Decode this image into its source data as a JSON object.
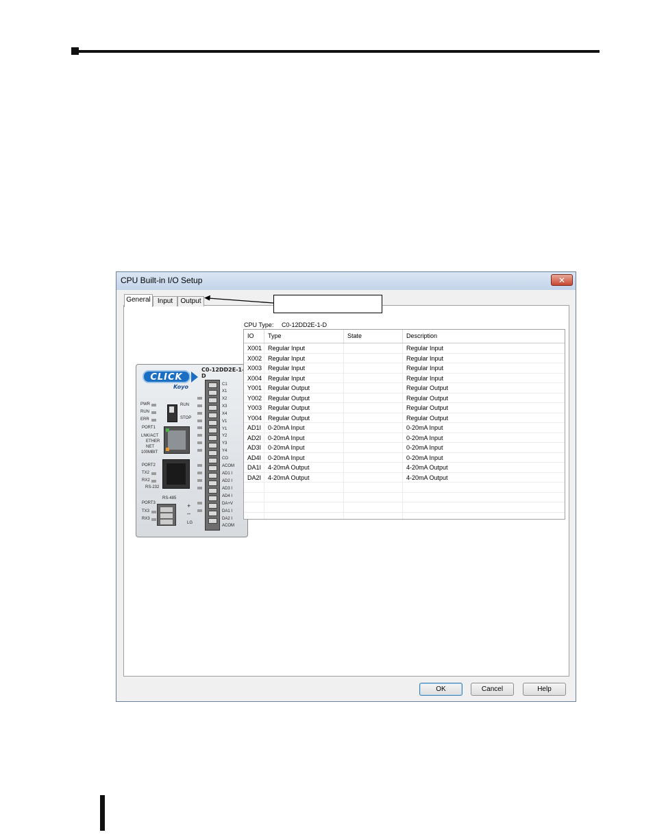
{
  "dialog": {
    "title": "CPU Built-in I/O Setup",
    "close_glyph": "✕",
    "tabs": [
      {
        "label": "General",
        "active": true
      },
      {
        "label": "Input",
        "active": false
      },
      {
        "label": "Output",
        "active": false
      }
    ],
    "cpu_type_label": "CPU Type:",
    "cpu_type_value": "C0-12DD2E-1-D",
    "buttons": {
      "ok": "OK",
      "cancel": "Cancel",
      "help": "Help"
    }
  },
  "device": {
    "brand": "CLICK",
    "sub_brand": "Koyo",
    "model": "C0-12DD2E-1-D",
    "left_labels": {
      "pwr": "PWR",
      "run": "RUN",
      "err": "ERR",
      "port1": "PORT1",
      "lnk_act": "LNK/ACT",
      "ether": "ETHER",
      "net": "NET",
      "speed": "100MBIT",
      "port2": "PORT2",
      "tx2": "TX2",
      "rx2": "RX2",
      "rs232": "RS-232",
      "rs485": "RS-485",
      "port3": "PORT3",
      "tx3": "TX3",
      "rx3": "RX3",
      "plus": "+",
      "minus": "–",
      "lg": "LG"
    },
    "switch_labels": {
      "run": "RUN",
      "stop": "STOP"
    },
    "terminals": [
      "C1",
      "X1",
      "X2",
      "X3",
      "X4",
      "V1",
      "Y1",
      "Y2",
      "Y3",
      "Y4",
      "CO",
      "ACOM",
      "AD1 I",
      "AD2 I",
      "AD3 I",
      "AD4 I",
      "DA+V",
      "DA1 I",
      "DA2 I",
      "ACOM"
    ]
  },
  "io_table": {
    "columns": [
      "IO",
      "Type",
      "State",
      "Description"
    ],
    "rows": [
      {
        "io": "X001",
        "type": "Regular Input",
        "state": "",
        "description": "Regular Input"
      },
      {
        "io": "X002",
        "type": "Regular Input",
        "state": "",
        "description": "Regular Input"
      },
      {
        "io": "X003",
        "type": "Regular Input",
        "state": "",
        "description": "Regular Input"
      },
      {
        "io": "X004",
        "type": "Regular Input",
        "state": "",
        "description": "Regular Input"
      },
      {
        "io": "Y001",
        "type": "Regular Output",
        "state": "",
        "description": "Regular Output"
      },
      {
        "io": "Y002",
        "type": "Regular Output",
        "state": "",
        "description": "Regular Output"
      },
      {
        "io": "Y003",
        "type": "Regular Output",
        "state": "",
        "description": "Regular Output"
      },
      {
        "io": "Y004",
        "type": "Regular Output",
        "state": "",
        "description": "Regular Output"
      },
      {
        "io": "AD1I",
        "type": "0-20mA Input",
        "state": "",
        "description": "0-20mA Input"
      },
      {
        "io": "AD2I",
        "type": "0-20mA Input",
        "state": "",
        "description": "0-20mA Input"
      },
      {
        "io": "AD3I",
        "type": "0-20mA Input",
        "state": "",
        "description": "0-20mA Input"
      },
      {
        "io": "AD4I",
        "type": "0-20mA Input",
        "state": "",
        "description": "0-20mA Input"
      },
      {
        "io": "DA1I",
        "type": "4-20mA Output",
        "state": "",
        "description": "4-20mA Output"
      },
      {
        "io": "DA2I",
        "type": "4-20mA Output",
        "state": "",
        "description": "4-20mA Output"
      },
      {
        "io": "",
        "type": "",
        "state": "",
        "description": ""
      },
      {
        "io": "",
        "type": "",
        "state": "",
        "description": ""
      },
      {
        "io": "",
        "type": "",
        "state": "",
        "description": ""
      },
      {
        "io": "",
        "type": "",
        "state": "",
        "description": ""
      }
    ]
  },
  "colors": {
    "titlebar": "#c3d4ea",
    "close_button": "#c7482f",
    "brand_blue": "#1a6fc2"
  }
}
